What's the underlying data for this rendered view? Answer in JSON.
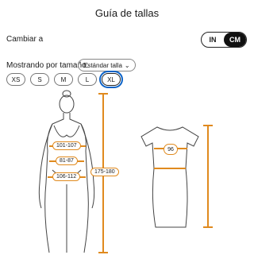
{
  "header": {
    "title": "Guía de tallas"
  },
  "units": {
    "label": "Cambiar a",
    "options": [
      "IN",
      "CM"
    ],
    "selected": "CM"
  },
  "size_filter": {
    "label": "Mostrando por tamaño:",
    "dropdown_value": "Estándar talla",
    "sizes": [
      "XS",
      "S",
      "M",
      "L",
      "XL"
    ],
    "selected": "XL"
  },
  "body_measurements": {
    "bust": "101-107",
    "waist": "81-87",
    "hips": "106-112",
    "height": "175-180"
  },
  "garment": {
    "bust": "96"
  },
  "colors": {
    "accent": "#e08a1e",
    "selected_outline": "#0b62c7"
  }
}
